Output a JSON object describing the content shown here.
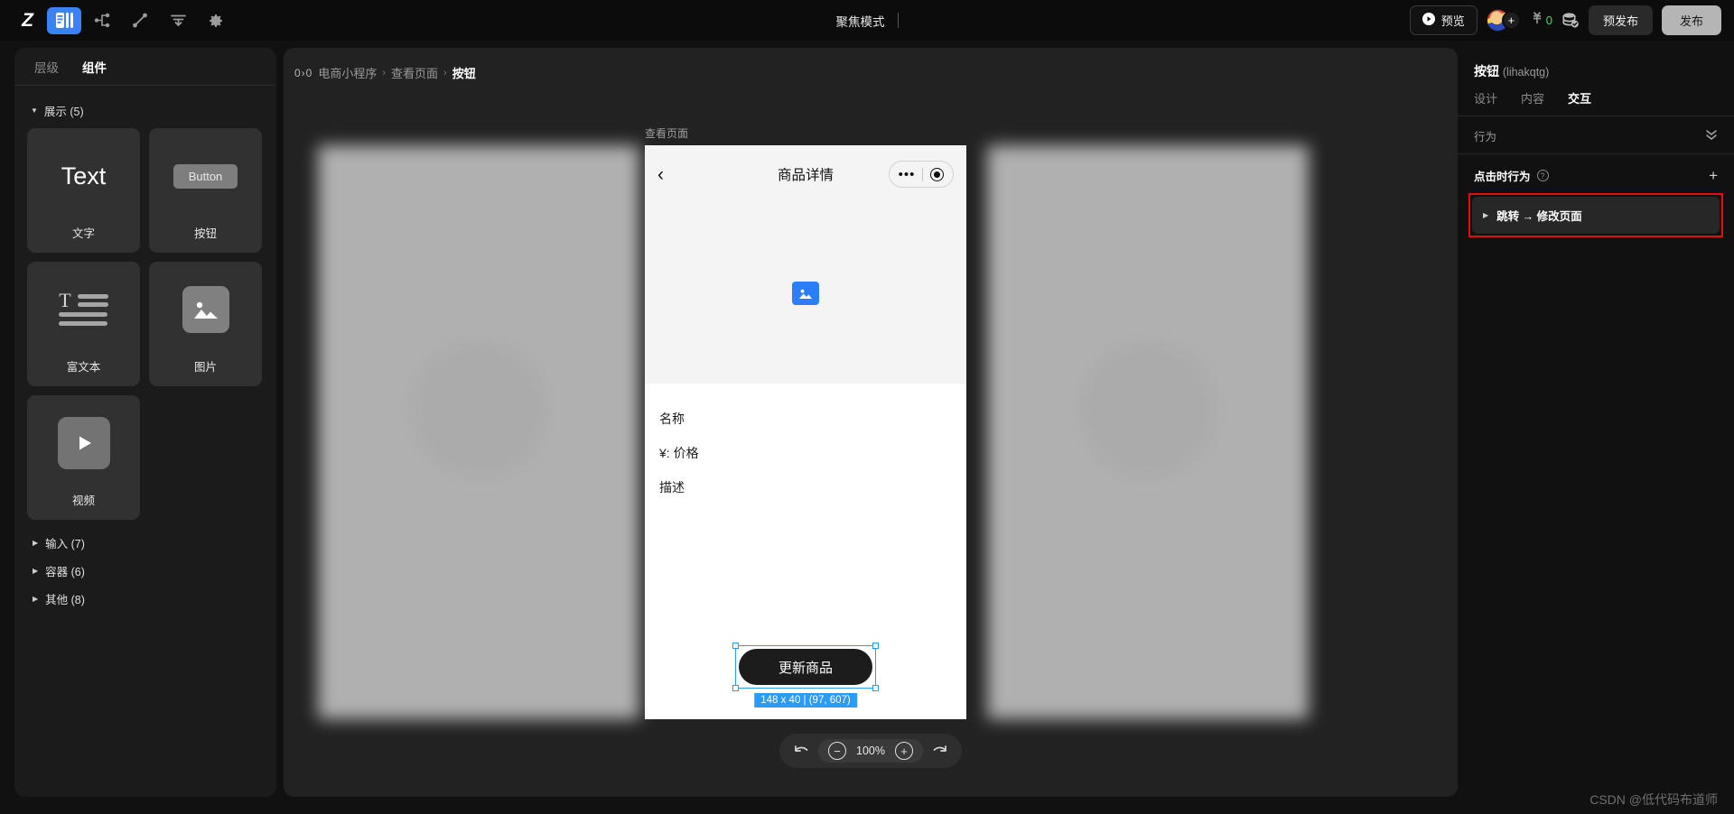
{
  "topbar": {
    "logo": "Z",
    "icons": [
      {
        "name": "panel-layout-icon",
        "active": true
      },
      {
        "name": "sitemap-icon",
        "active": false
      },
      {
        "name": "plugin-icon",
        "active": false
      },
      {
        "name": "align-icon",
        "active": false
      },
      {
        "name": "gear-icon",
        "active": false
      }
    ],
    "focus_mode": "聚焦模式",
    "preview_label": "预览",
    "coin_count": "0",
    "prerelease_label": "预发布",
    "publish_label": "发布"
  },
  "left_panel": {
    "tabs": [
      {
        "label": "层级",
        "active": false
      },
      {
        "label": "组件",
        "active": true
      }
    ],
    "sections": [
      {
        "label": "展示 (5)",
        "expanded": true
      },
      {
        "label": "输入 (7)",
        "expanded": false
      },
      {
        "label": "容器 (6)",
        "expanded": false
      },
      {
        "label": "其他 (8)",
        "expanded": false
      }
    ],
    "components": [
      {
        "label": "文字",
        "visual": "Text"
      },
      {
        "label": "按钮",
        "visual": "Button"
      },
      {
        "label": "富文本",
        "visual": "rich-text-icon"
      },
      {
        "label": "图片",
        "visual": "image-icon"
      },
      {
        "label": "视频",
        "visual": "video-play-icon"
      }
    ]
  },
  "canvas": {
    "breadcrumb_badge": "0›0",
    "breadcrumb": [
      "电商小程序",
      "查看页面",
      "按钮"
    ],
    "separator": "›",
    "phone_tag": "查看页面",
    "phone": {
      "title": "商品详情",
      "rows": [
        "名称",
        "¥:  价格",
        "描述"
      ],
      "button_label": "更新商品"
    },
    "selection_badge": "148 x 40 | (97, 607)",
    "zoom": {
      "percent": "100%",
      "undo": "undo-icon",
      "redo": "redo-icon",
      "zoom_out": "−",
      "zoom_in": "+"
    }
  },
  "right_panel": {
    "component_name": "按钮",
    "component_id": "(lihakqtg)",
    "tabs": [
      {
        "label": "设计",
        "active": false
      },
      {
        "label": "内容",
        "active": false
      },
      {
        "label": "交互",
        "active": true
      }
    ],
    "section_label": "行为",
    "subsection_label": "点击时行为",
    "help_glyph": "?",
    "add_glyph": "+",
    "behaviors": [
      {
        "label": "跳转 → 修改页面",
        "highlighted": true
      }
    ]
  },
  "watermark": "CSDN @低代码布道师",
  "colors": {
    "accent_blue": "#3b82f6",
    "selection_blue": "#2b9bf6",
    "highlight_red": "#e01010",
    "coin_green": "#3ddc6e"
  }
}
